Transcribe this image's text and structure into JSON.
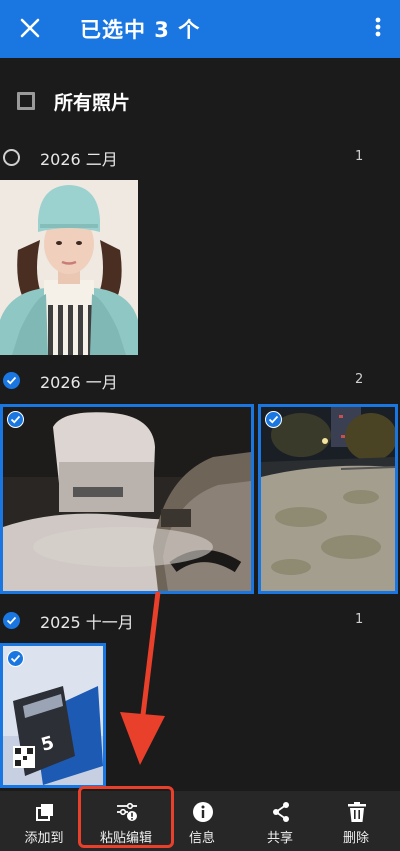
{
  "header": {
    "title": "已选中 3 个"
  },
  "all_photos": {
    "label": "所有照片"
  },
  "sections": [
    {
      "date": "2026 二月",
      "count": "1",
      "selected": false
    },
    {
      "date": "2026 一月",
      "count": "2",
      "selected": true
    },
    {
      "date": "2025 十一月",
      "count": "1",
      "selected": true
    }
  ],
  "photos": [
    {
      "id": "portrait",
      "selected": false
    },
    {
      "id": "snow-car",
      "selected": true
    },
    {
      "id": "night-street",
      "selected": true
    },
    {
      "id": "box-product",
      "selected": true
    }
  ],
  "bottom_bar": [
    {
      "label": "添加到",
      "icon": "add-to-icon"
    },
    {
      "label": "粘贴编辑",
      "icon": "paste-edit-icon"
    },
    {
      "label": "信息",
      "icon": "info-icon"
    },
    {
      "label": "共享",
      "icon": "share-icon"
    },
    {
      "label": "删除",
      "icon": "delete-icon"
    }
  ],
  "colors": {
    "accent": "#1a77e1",
    "background": "#1b1b1b",
    "annotation": "#e8402a"
  }
}
